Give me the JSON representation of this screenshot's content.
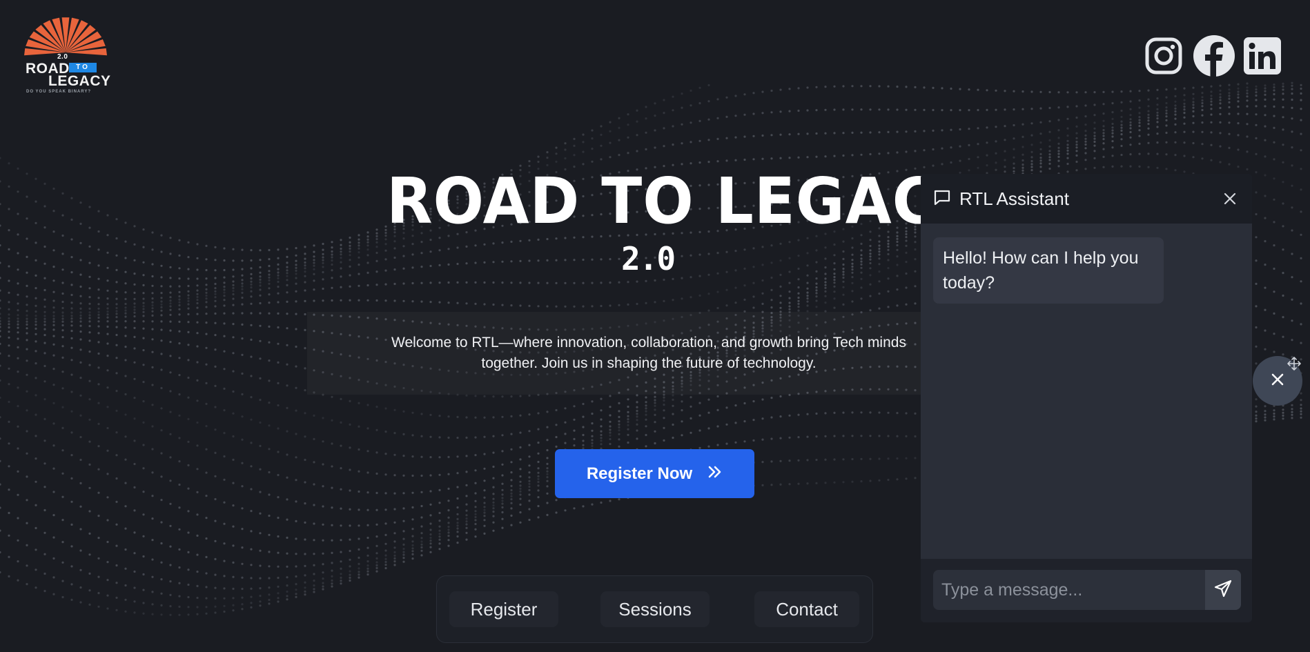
{
  "logo": {
    "version": "2.0",
    "line1": "ROAD",
    "line2": "TO",
    "line3": "LEGACY",
    "tagline": "DO YOU SPEAK BINARY?",
    "colors": {
      "rays": "#e8643c",
      "band": "#1e88e5"
    }
  },
  "social": [
    {
      "name": "instagram",
      "icon": "instagram-icon"
    },
    {
      "name": "facebook",
      "icon": "facebook-icon"
    },
    {
      "name": "linkedin",
      "icon": "linkedin-icon"
    }
  ],
  "hero": {
    "title": "ROAD TO LEGACY",
    "version": "2.0",
    "description_line1": "Welcome to RTL—where innovation, collaboration, and growth bring Tech minds",
    "description_line2": "together. Join us in shaping the future of technology."
  },
  "cta": {
    "label": "Register Now",
    "icon": "double-chevron-right-icon",
    "color": "#2563eb"
  },
  "bottom_nav": [
    {
      "label": "Register"
    },
    {
      "label": "Sessions"
    },
    {
      "label": "Contact"
    }
  ],
  "chat": {
    "title": "RTL Assistant",
    "header_icon": "message-square-icon",
    "messages": [
      {
        "from": "assistant",
        "text": "Hello! How can I help you today?"
      }
    ],
    "input": {
      "placeholder": "Type a message...",
      "value": ""
    },
    "send_icon": "send-icon"
  },
  "chat_toggle": {
    "icon": "close-icon"
  },
  "colors": {
    "background": "#1a1c22",
    "panel": "#252933",
    "accent": "#2563eb"
  }
}
